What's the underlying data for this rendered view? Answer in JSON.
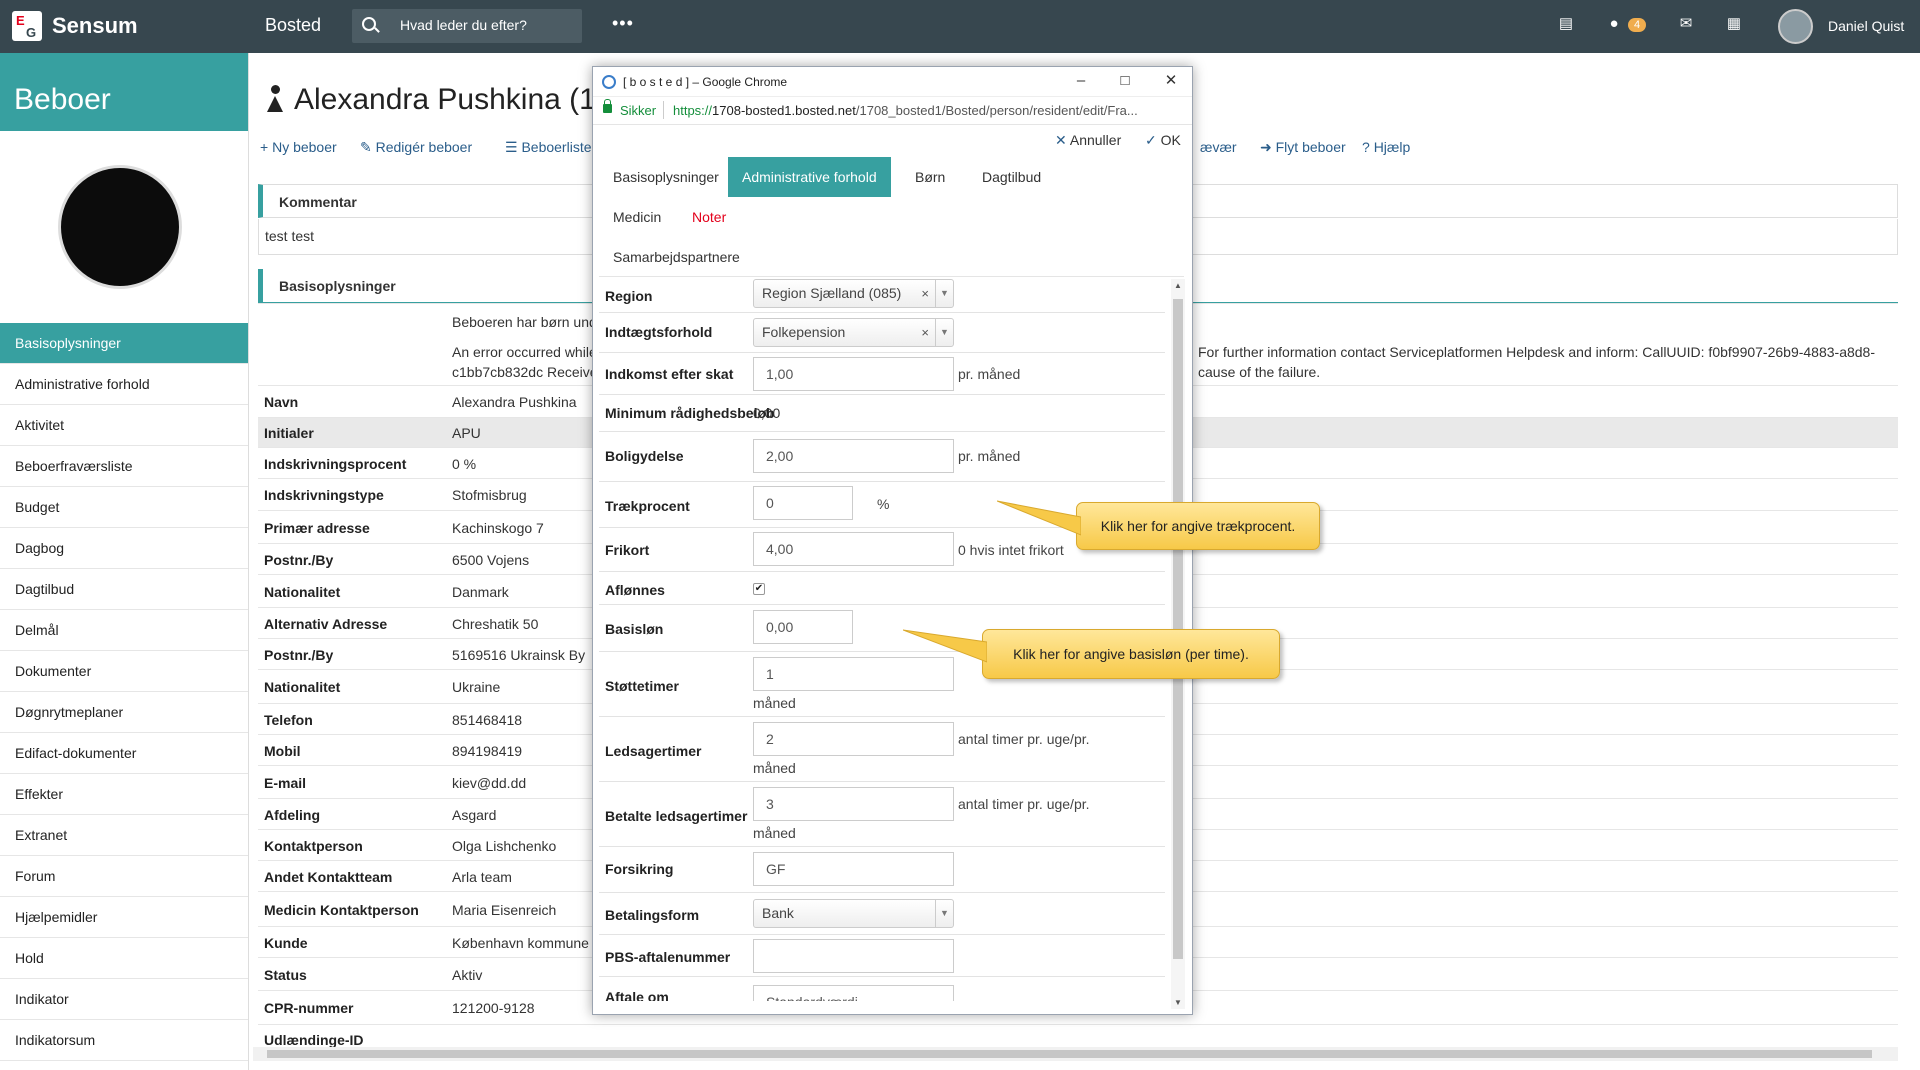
{
  "topbar": {
    "logo_letters": [
      "E",
      "G"
    ],
    "app_name": "Sensum",
    "section": "Bosted",
    "search_placeholder": "Hvad leder du efter?",
    "more": "•••",
    "chat_badge": "4",
    "user_name": "Daniel Quist",
    "icons": [
      "document-icon",
      "chat-icon",
      "inbox-icon",
      "calendar-icon",
      "user-avatar-icon"
    ]
  },
  "sidebar": {
    "header": "Beboer",
    "items": [
      "Basisoplysninger",
      "Administrative forhold",
      "Aktivitet",
      "Beboerfraværsliste",
      "Budget",
      "Dagbog",
      "Dagtilbud",
      "Delmål",
      "Dokumenter",
      "Døgnrytmeplaner",
      "Edifact-dokumenter",
      "Effekter",
      "Extranet",
      "Forum",
      "Hjælpemidler",
      "Hold",
      "Indikator",
      "Indikatorsum"
    ],
    "active_index": 0
  },
  "main": {
    "title": "Alexandra Pushkina (1",
    "toolbar": [
      "Ny beboer",
      "Redigér beboer",
      "Beboerliste",
      "ævær",
      "Flyt beboer",
      "Hjælp"
    ],
    "comment_header": "Kommentar",
    "comment_text": "test test",
    "basic_header": "Basisoplysninger",
    "error_lines": [
      "Beboeren har børn unde",
      "An error occurred while",
      "c1bb7cb832dc Received"
    ],
    "error_right_lines": [
      "For further information contact Serviceplatformen Helpdesk and inform: CallUUID: f0bf9907-26b9-4883-a8d8-",
      "cause of the failure."
    ],
    "rows": [
      {
        "label": "Navn",
        "value": "Alexandra Pushkina"
      },
      {
        "label": "Initialer",
        "value": "APU"
      },
      {
        "label": "Indskrivningsprocent",
        "value": "0 %"
      },
      {
        "label": "Indskrivningstype",
        "value": "Stofmisbrug"
      },
      {
        "label": "Primær adresse",
        "value": "Kachinskogo 7"
      },
      {
        "label": "Postnr./By",
        "value": "6500  Vojens"
      },
      {
        "label": "Nationalitet",
        "value": "Danmark"
      },
      {
        "label": "Alternativ Adresse",
        "value": "Chreshatik 50"
      },
      {
        "label": "Postnr./By",
        "value": "5169516  Ukrainsk By"
      },
      {
        "label": "Nationalitet",
        "value": "Ukraine"
      },
      {
        "label": "Telefon",
        "value": "851468418"
      },
      {
        "label": "Mobil",
        "value": "894198419"
      },
      {
        "label": "E-mail",
        "value": "kiev@dd.dd"
      },
      {
        "label": "Afdeling",
        "value": "Asgard"
      },
      {
        "label": "Kontaktperson",
        "value": "Olga Lishchenko"
      },
      {
        "label": "Andet Kontaktteam",
        "value": "Arla team"
      },
      {
        "label": "Medicin Kontaktperson",
        "value": "Maria Eisenreich"
      },
      {
        "label": "Kunde",
        "value": "København kommune"
      },
      {
        "label": "Status",
        "value": "Aktiv"
      },
      {
        "label": "CPR-nummer",
        "value": "121200-9128"
      },
      {
        "label": "Udlændinge-ID",
        "value": ""
      }
    ]
  },
  "popup": {
    "window_title": "[ b o s t e d ] – Google Chrome",
    "secure_label": "Sikker",
    "url_scheme": "https://",
    "url_host": "1708-bosted1.bosted.net",
    "url_path": "/1708_bosted1/Bosted/person/resident/edit/Fra...",
    "cancel_label": "Annuller",
    "ok_label": "OK",
    "tabs": [
      "Basisoplysninger",
      "Administrative forhold",
      "Børn",
      "Dagtilbud",
      "Medicin",
      "Noter",
      "Samarbejdspartnere"
    ],
    "active_tab_index": 1,
    "form": {
      "region_label": "Region",
      "region_value": "Region Sjælland (085)",
      "income_label": "Indtægtsforhold",
      "income_value": "Folkepension",
      "net_income_label": "Indkomst efter skat",
      "net_income_value": "1,00",
      "net_income_suffix": "pr. måned",
      "min_label": "Minimum rådighedsbeløb",
      "min_value": "0,00",
      "housing_label": "Boligydelse",
      "housing_value": "2,00",
      "housing_suffix": "pr. måned",
      "deduction_label": "Trækprocent",
      "deduction_value": "0",
      "deduction_suffix": "%",
      "frikort_label": "Frikort",
      "frikort_value": "4,00",
      "frikort_suffix": "0 hvis intet frikort",
      "paid_label": "Aflønnes",
      "paid_checked": "✔",
      "basepay_label": "Basisløn",
      "basepay_value": "0,00",
      "support_label": "Støttetimer",
      "support_value": "1",
      "support_suffix": "måned",
      "companion_label": "Ledsagertimer",
      "companion_value": "2",
      "companion_suffix1": "antal timer pr. uge/pr.",
      "companion_suffix2": "måned",
      "paid_companion_label": "Betalte ledsagertimer",
      "paid_companion_value": "3",
      "paid_companion_suffix1": "antal timer pr. uge/pr.",
      "paid_companion_suffix2": "måned",
      "insurance_label": "Forsikring",
      "insurance_value": "GF",
      "payment_label": "Betalingsform",
      "payment_value": "Bank",
      "pbs_label": "PBS-aftalenummer",
      "pbs_value": "",
      "agreement_label": "Aftale om",
      "agreement_value": "Standardværdi"
    }
  },
  "callouts": {
    "deduction": "Klik her for angive trækprocent.",
    "basepay": "Klik her for angive basisløn (per time)."
  },
  "colors": {
    "accent": "#37a0a0",
    "topbar": "#37474f",
    "error": "#e3001b",
    "callout": "#f7c948"
  }
}
